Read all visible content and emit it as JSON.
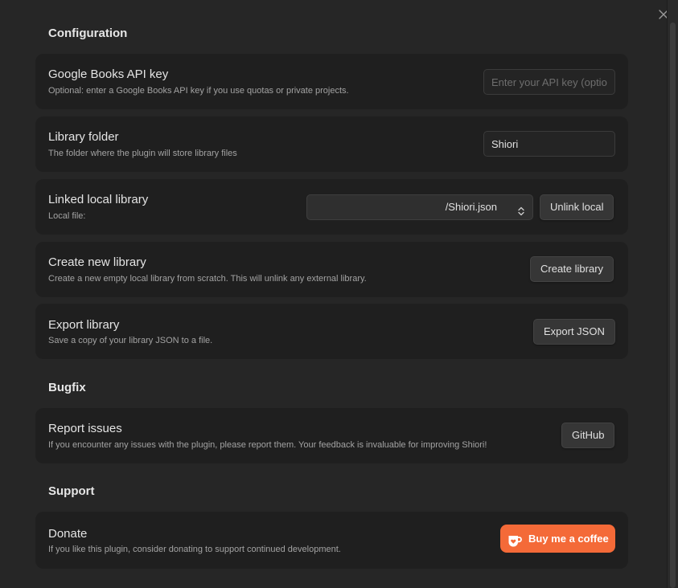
{
  "sections": {
    "configuration": "Configuration",
    "bugfix": "Bugfix",
    "support": "Support"
  },
  "settings": {
    "api_key": {
      "name": "Google Books API key",
      "desc": "Optional: enter a Google Books API key if you use quotas or private projects.",
      "placeholder": "Enter your API key (optional)",
      "value": ""
    },
    "library_folder": {
      "name": "Library folder",
      "desc": "The folder where the plugin will store library files",
      "value": "Shiori"
    },
    "linked_library": {
      "name": "Linked local library",
      "desc": "Local file:",
      "selected": "/Shiori.json",
      "unlink_label": "Unlink local"
    },
    "create_library": {
      "name": "Create new library",
      "desc": "Create a new empty local library from scratch. This will unlink any external library.",
      "button": "Create library"
    },
    "export_library": {
      "name": "Export library",
      "desc": "Save a copy of your library JSON to a file.",
      "button": "Export JSON"
    },
    "report_issues": {
      "name": "Report issues",
      "desc": "If you encounter any issues with the plugin, please report them. Your feedback is invaluable for improving Shiori!",
      "button": "GitHub"
    },
    "donate": {
      "name": "Donate",
      "desc": "If you like this plugin, consider donating to support continued development.",
      "button": "Buy me a coffee"
    }
  },
  "colors": {
    "background": "#262626",
    "card": "#1f1f1f",
    "accent_coffee": "#f46a38"
  },
  "icons": {
    "close": "close-icon",
    "chevron": "chevron-updown-icon",
    "coffee": "coffee-cup-icon"
  }
}
